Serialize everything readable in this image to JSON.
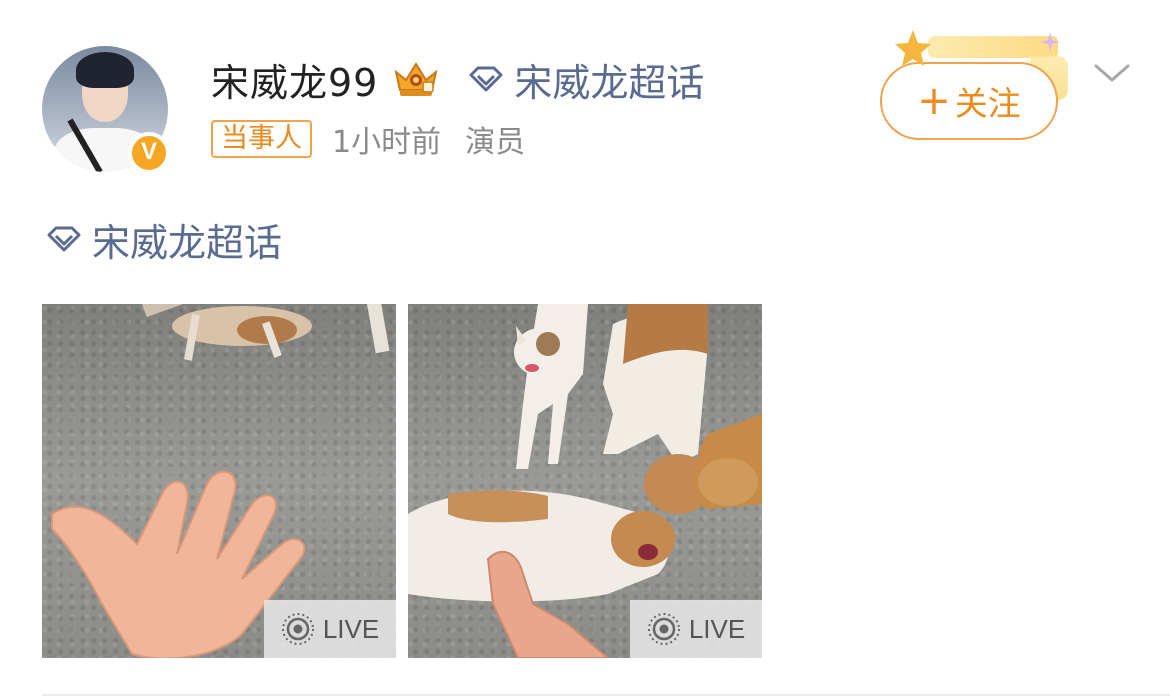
{
  "post": {
    "username": "宋威龙99",
    "super_topic_label": "宋威龙超话",
    "tag_label": "当事人",
    "time": "1小时前",
    "role": "演员",
    "verified_badge": "V",
    "follow_button": {
      "plus": "+",
      "label": "关注"
    },
    "topic_link": "宋威龙超话",
    "images": [
      {
        "alt": "hand reaching toward dogs on gravel",
        "live_label": "LIVE"
      },
      {
        "alt": "dogs playing on gravel, hand petting a dog",
        "live_label": "LIVE"
      }
    ]
  },
  "colors": {
    "accent_orange": "#ef8b1c",
    "topic_blue": "#5a6b92",
    "meta_gray": "#8a8a8a",
    "verified_yellow": "#f5a623"
  },
  "icons": {
    "crown": "crown-level-icon",
    "diamond": "super-topic-diamond-icon",
    "chevron": "chevron-down-icon",
    "live": "live-photo-icon"
  }
}
